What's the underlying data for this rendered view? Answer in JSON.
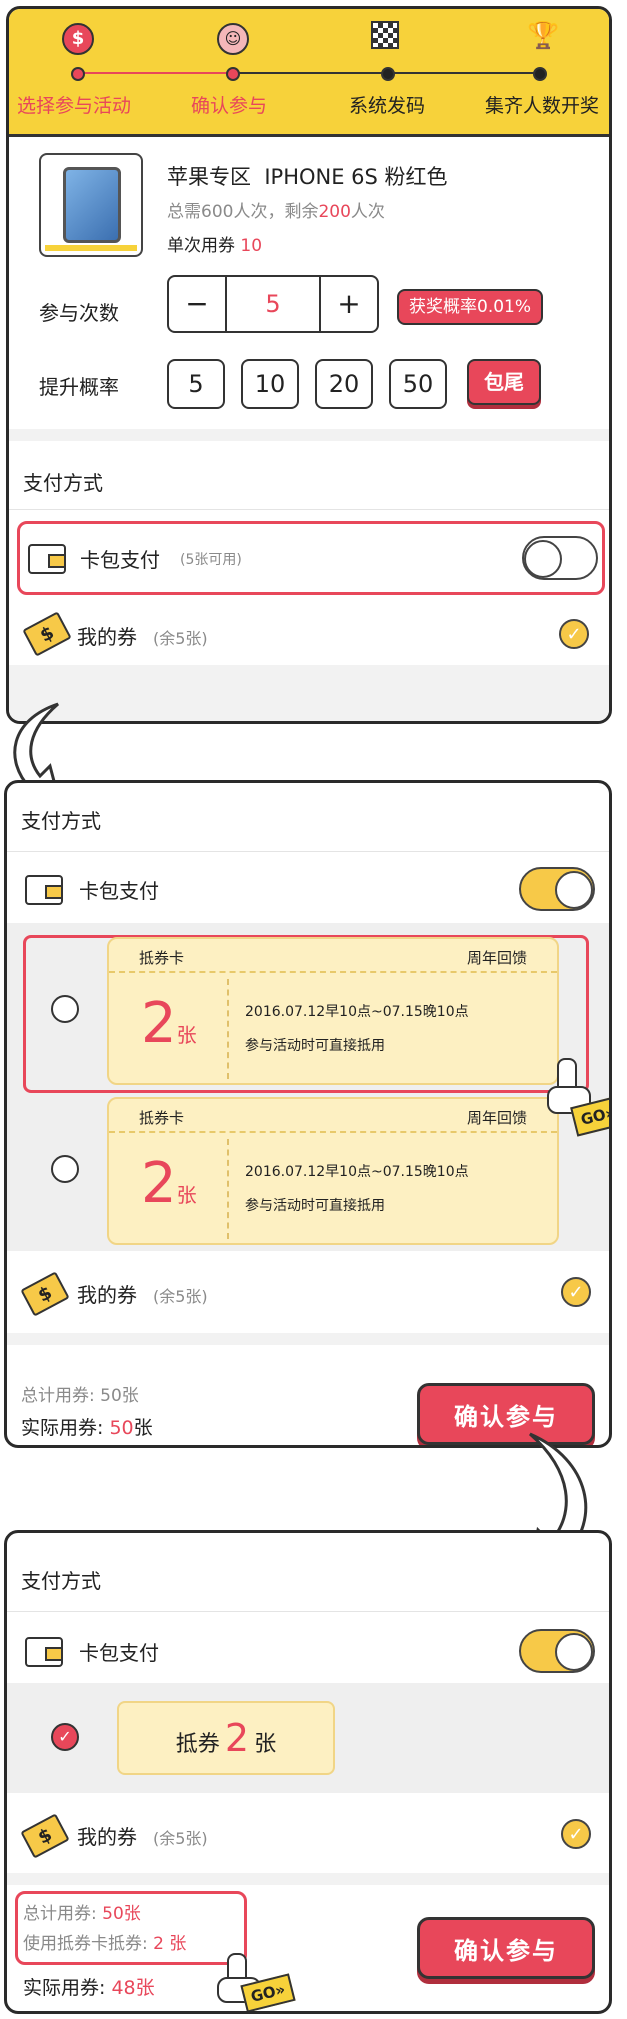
{
  "steps": [
    {
      "label": "选择参与活动",
      "icon": "dollar-icon",
      "active": true
    },
    {
      "label": "确认参与",
      "icon": "user-icon",
      "active": true
    },
    {
      "label": "系统发码",
      "icon": "checkered-flag-icon",
      "active": false
    },
    {
      "label": "集齐人数开奖",
      "icon": "trophy-icon",
      "active": false
    }
  ],
  "product": {
    "title": "苹果专区  IPHONE 6S 粉红色",
    "total_prefix": "总需600人次，剩余",
    "remain": "200",
    "remain_suffix": "人次",
    "per_label": "单次用券",
    "per_value": "10"
  },
  "participate": {
    "label": "参与次数",
    "minus": "−",
    "count": "5",
    "plus": "+",
    "odds": "获奖概率0.01%"
  },
  "boost": {
    "label": "提升概率",
    "options": [
      "5",
      "10",
      "20",
      "50"
    ],
    "all_label": "包尾"
  },
  "panel1": {
    "pay_title": "支付方式",
    "wallet_label": "卡包支付",
    "wallet_hint": "(5张可用)",
    "coupon_label": "我的券",
    "coupon_hint": "(余5张)"
  },
  "panel2": {
    "pay_title": "支付方式",
    "wallet_label": "卡包支付",
    "coupons": [
      {
        "type": "抵券卡",
        "tag": "周年回馈",
        "count": "2",
        "unit": "张",
        "date": "2016.07.12早10点~07.15晚10点",
        "note": "参与活动时可直接抵用"
      },
      {
        "type": "抵券卡",
        "tag": "周年回馈",
        "count": "2",
        "unit": "张",
        "date": "2016.07.12早10点~07.15晚10点",
        "note": "参与活动时可直接抵用"
      }
    ],
    "coupon_label": "我的券",
    "coupon_hint": "(余5张)",
    "total_label": "总计用券:",
    "total_value": "50张",
    "actual_label": "实际用券:",
    "actual_value": "50",
    "actual_unit": "张",
    "confirm": "确认参与"
  },
  "panel3": {
    "pay_title": "支付方式",
    "wallet_label": "卡包支付",
    "selected_prefix": "抵券",
    "selected_count": "2",
    "selected_unit": "张",
    "coupon_label": "我的券",
    "coupon_hint": "(余5张)",
    "total_label": "总计用券:",
    "total_value": "50张",
    "deduct_label": "使用抵券卡抵券:",
    "deduct_value": "2 张",
    "actual_label": "实际用券:",
    "actual_value": "48张",
    "confirm": "确认参与"
  },
  "go_label": "GO»",
  "colors": {
    "yellow": "#f7d23a",
    "red": "#e8475a",
    "coupon": "#fdf0c2"
  }
}
